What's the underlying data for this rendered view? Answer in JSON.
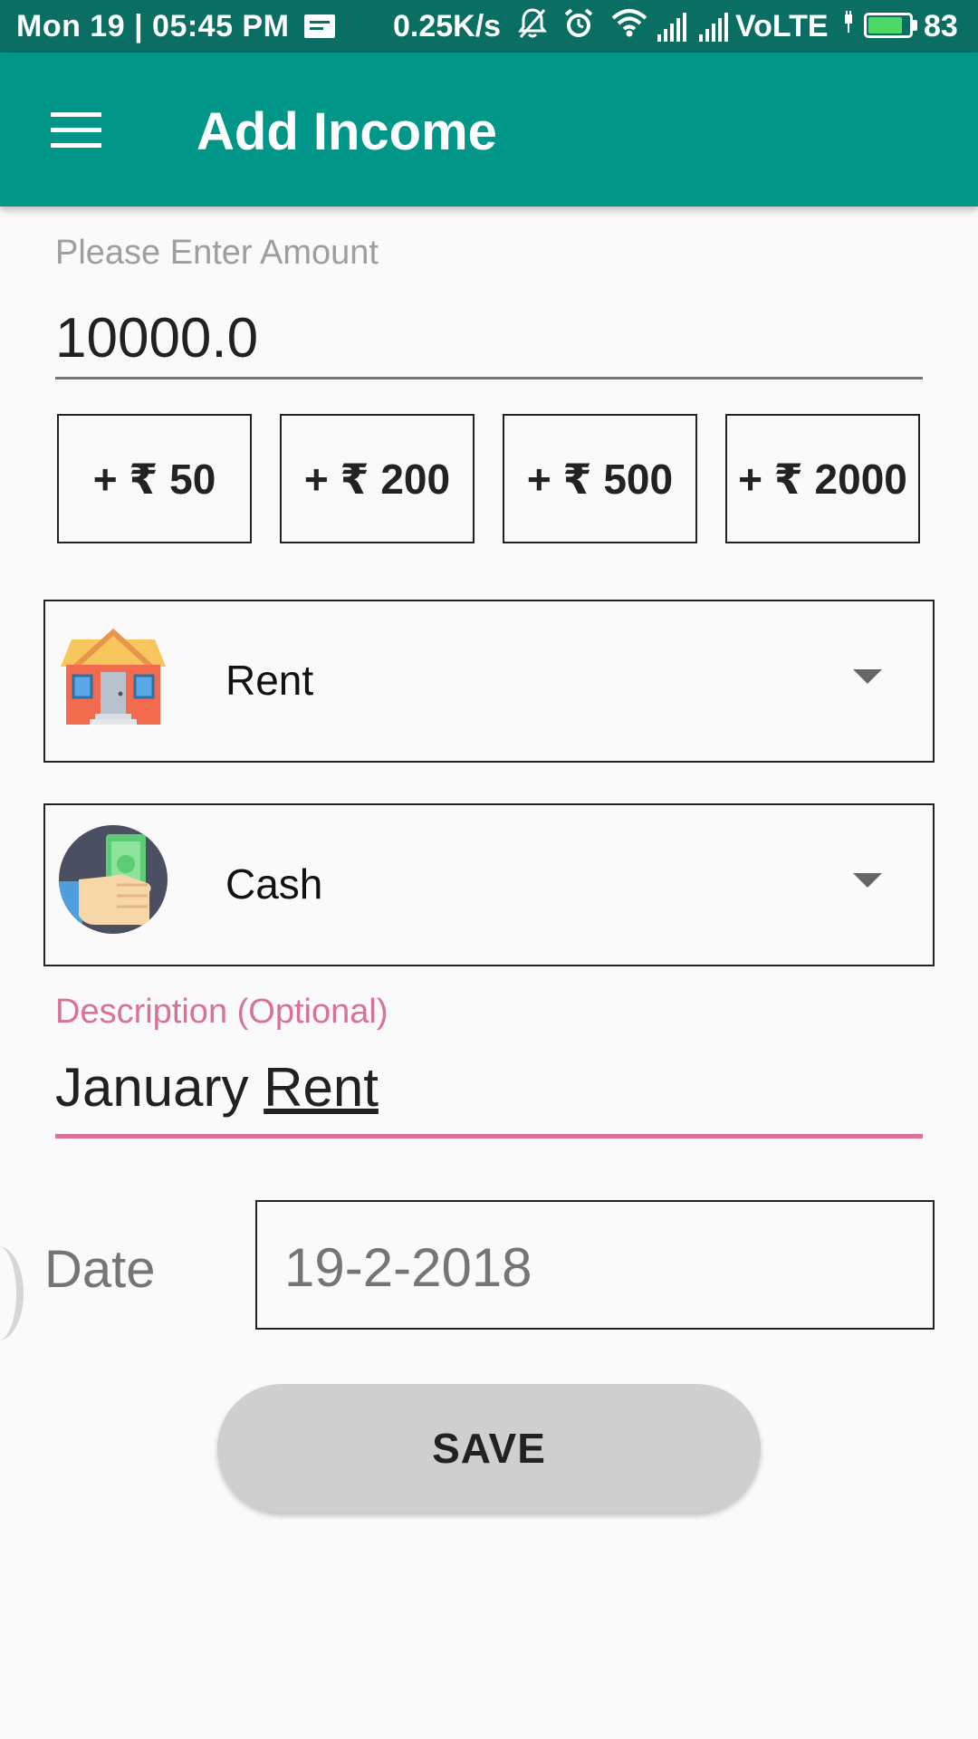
{
  "status_bar": {
    "time": "Mon 19 | 05:45 PM",
    "net_speed": "0.25K/s",
    "network": "VoLTE",
    "battery_level": "83",
    "battery_fraction": 0.83,
    "icons": [
      "notes-icon",
      "mute-icon",
      "alarm-icon",
      "wifi-icon",
      "signal-icon",
      "battery-icon"
    ]
  },
  "app_bar": {
    "title": "Add Income",
    "menu_icon": "hamburger-menu-icon",
    "color": "#009688"
  },
  "amount": {
    "label": "Please Enter Amount",
    "value": "10000.0"
  },
  "quick_add": [
    "+ ₹ 50",
    "+ ₹ 200",
    "+ ₹ 500",
    "+ ₹ 2000"
  ],
  "category": {
    "selected": "Rent",
    "icon": "house-icon"
  },
  "payment_mode": {
    "selected": "Cash",
    "icon": "cash-in-hand-icon"
  },
  "description": {
    "label": "Description (Optional)",
    "value_plain": "January ",
    "value_underlined": "Rent",
    "accent_color": "#d9719a"
  },
  "date": {
    "label": "Date",
    "value": "19-2-2018"
  },
  "save_button": {
    "label": "SAVE"
  }
}
